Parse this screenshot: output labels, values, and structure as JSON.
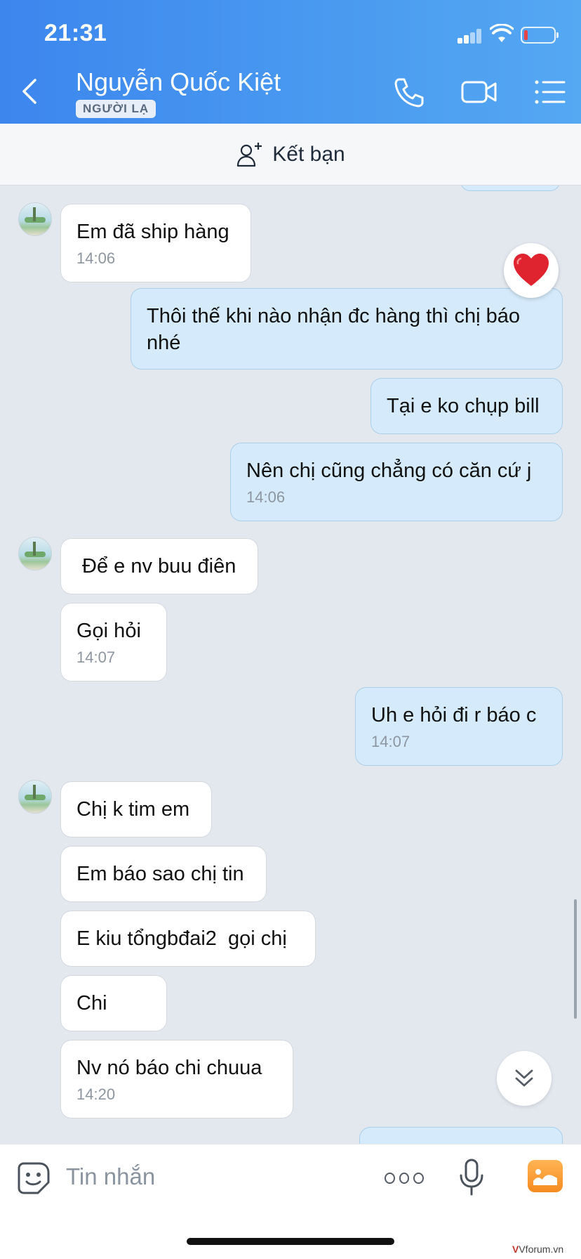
{
  "status_bar": {
    "time": "21:31"
  },
  "header": {
    "contact_name": "Nguyễn Quốc Kiệt",
    "badge": "NGƯỜI LẠ",
    "accent_color": "#3c86ee"
  },
  "add_friend": {
    "label": "Kết bạn"
  },
  "messages": [
    {
      "dir": "in",
      "text": "Em đã ship hàng",
      "time": "14:06"
    },
    {
      "dir": "out",
      "text": "Thôi thế khi nào nhận đc hàng thì chị báo nhé",
      "reaction": "heart"
    },
    {
      "dir": "out",
      "text": "Tại e ko chụp bill"
    },
    {
      "dir": "out",
      "text": "Nên chị cũng chẳng có căn cứ j",
      "time": "14:06"
    },
    {
      "dir": "in",
      "text": " Để e nv buu điên"
    },
    {
      "dir": "in",
      "text": "Gọi hỏi",
      "time": "14:07"
    },
    {
      "dir": "out",
      "text": "Uh e hỏi đi r báo c",
      "time": "14:07"
    },
    {
      "dir": "in",
      "text": "Chị k tim em"
    },
    {
      "dir": "in",
      "text": "Em báo sao chị tin"
    },
    {
      "dir": "in",
      "text": "E kiu tổngbđai2  gọi chị"
    },
    {
      "dir": "in",
      "text": "Chi"
    },
    {
      "dir": "in",
      "text": "Nv nó báo chi chuua",
      "time": "14:20"
    }
  ],
  "input": {
    "placeholder": "Tin nhắn"
  },
  "watermark": {
    "brand": "V",
    "site": "Vforum.vn"
  },
  "icons": [
    "back-icon",
    "phone-icon",
    "video-icon",
    "menu-icon",
    "add-friend-icon",
    "heart-icon",
    "chevron-double-down-icon",
    "sticker-icon",
    "more-icon",
    "mic-icon",
    "photo-icon"
  ]
}
